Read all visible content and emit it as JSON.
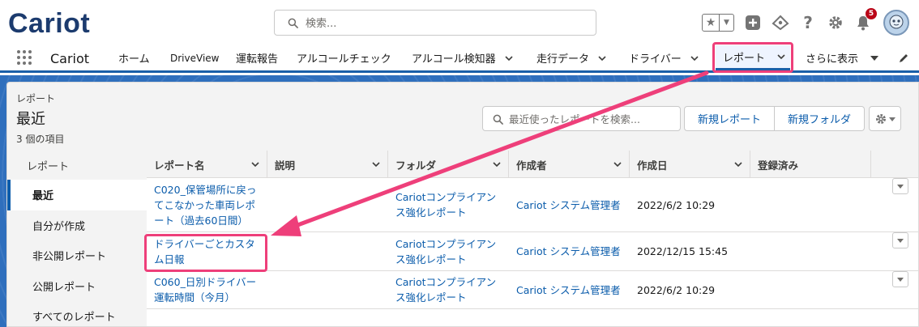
{
  "header": {
    "logo_text": "Cariot",
    "search_placeholder": "検索...",
    "notification_count": "5",
    "help_label": "?"
  },
  "nav": {
    "app_name": "Cariot",
    "items": [
      {
        "label": "ホーム",
        "has_menu": false
      },
      {
        "label": "DriveView",
        "has_menu": false
      },
      {
        "label": "運転報告",
        "has_menu": false
      },
      {
        "label": "アルコールチェック",
        "has_menu": false
      },
      {
        "label": "アルコール検知器",
        "has_menu": true
      },
      {
        "label": "走行データ",
        "has_menu": true
      },
      {
        "label": "ドライバー",
        "has_menu": true
      },
      {
        "label": "レポート",
        "has_menu": true,
        "active": true
      }
    ],
    "more_label": "さらに表示"
  },
  "page": {
    "eyebrow": "レポート",
    "title": "最近",
    "item_count": "3 個の項目",
    "search_placeholder": "最近使ったレポートを検索...",
    "new_report_label": "新規レポート",
    "new_folder_label": "新規フォルダ"
  },
  "sidebar": {
    "header": "レポート",
    "items": [
      {
        "label": "最近",
        "selected": true
      },
      {
        "label": "自分が作成",
        "selected": false
      },
      {
        "label": "非公開レポート",
        "selected": false
      },
      {
        "label": "公開レポート",
        "selected": false
      },
      {
        "label": "すべてのレポート",
        "selected": false
      }
    ]
  },
  "table": {
    "columns": [
      "レポート名",
      "説明",
      "フォルダ",
      "作成者",
      "作成日",
      "登録済み"
    ],
    "rows": [
      {
        "name": "C020_保管場所に戻ってこなかった車両レポート（過去60日間）",
        "description": "",
        "folder": "Cariotコンプライアンス強化レポート",
        "creator": "Cariot システム管理者",
        "created": "2022/6/2 10:29",
        "subscribed": ""
      },
      {
        "name": "ドライバーごとカスタム日報",
        "description": "",
        "folder": "Cariotコンプライアンス強化レポート",
        "creator": "Cariot システム管理者",
        "created": "2022/12/15 15:45",
        "subscribed": ""
      },
      {
        "name": "C060_日別ドライバー運転時間（今月）",
        "description": "",
        "folder": "Cariotコンプライアンス強化レポート",
        "creator": "Cariot システム管理者",
        "created": "2022/6/2 10:29",
        "subscribed": ""
      }
    ]
  },
  "icons": {
    "search": "search-icon",
    "favorite": "star-icon",
    "add": "plus-icon",
    "setup_assistant": "cloud-icon",
    "help": "question-icon",
    "settings": "gear-icon",
    "notifications": "bell-icon",
    "app_launcher": "waffle-icon",
    "edit_nav": "pencil-icon",
    "row_menu": "chevron-down-icon"
  },
  "colors": {
    "brand_navy": "#1c3b6e",
    "link": "#0b5cab",
    "nav_accent": "#1a5fa8",
    "highlight": "#ee3f7a",
    "badge": "#ba0517"
  }
}
